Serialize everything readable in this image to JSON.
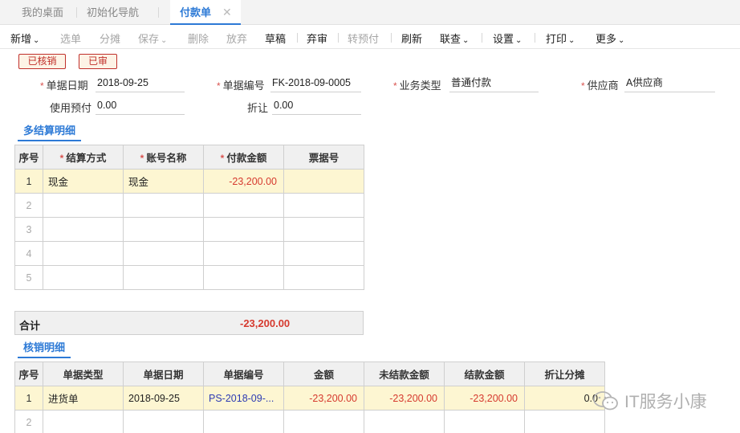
{
  "tabs": {
    "items": [
      "我的桌面",
      "初始化导航"
    ],
    "active": "付款单",
    "close": "✕"
  },
  "toolbar": {
    "new": "新增",
    "select": "选单",
    "split": "分摊",
    "save": "保存",
    "delete": "删除",
    "discard": "放弃",
    "draft": "草稿",
    "unaudit": "弃审",
    "to_prepay": "转预付",
    "refresh": "刷新",
    "linked_query": "联查",
    "settings": "设置",
    "print": "打印",
    "more": "更多"
  },
  "stamps": {
    "verified": "已核销",
    "audited": "已审"
  },
  "form": {
    "doc_date_label": "单据日期",
    "doc_date": "2018-09-25",
    "doc_no_label": "单据编号",
    "doc_no": "FK-2018-09-0005",
    "biz_type_label": "业务类型",
    "biz_type": "普通付款",
    "supplier_label": "供应商",
    "supplier": "A供应商",
    "use_prepay_label": "使用预付",
    "use_prepay": "0.00",
    "discount_label": "折让",
    "discount": "0.00"
  },
  "settlement": {
    "title": "多结算明细",
    "columns": [
      "序号",
      "结算方式",
      "账号名称",
      "付款金额",
      "票据号"
    ],
    "rows": [
      [
        "1",
        "现金",
        "现金",
        "-23,200.00",
        ""
      ],
      [
        "2",
        "",
        "",
        "",
        ""
      ],
      [
        "3",
        "",
        "",
        "",
        ""
      ],
      [
        "4",
        "",
        "",
        "",
        ""
      ],
      [
        "5",
        "",
        "",
        "",
        ""
      ]
    ],
    "total_label": "合计",
    "total_value": "-23,200.00"
  },
  "verify": {
    "title": "核销明细",
    "columns": [
      "序号",
      "单据类型",
      "单据日期",
      "单据编号",
      "金额",
      "未结款金额",
      "结款金额",
      "折让分摊"
    ],
    "rows": [
      [
        "1",
        "进货单",
        "2018-09-25",
        "PS-2018-09-...",
        "-23,200.00",
        "-23,200.00",
        "-23,200.00",
        "0.0"
      ],
      [
        "2",
        "",
        "",
        "",
        "",
        "",
        "",
        ""
      ]
    ]
  },
  "watermark": "IT服务小康",
  "colors": {
    "accent": "#2d7ad6",
    "negative": "#d63a2f",
    "stamp": "#c0302b",
    "highlight_row": "#fdf6d2"
  }
}
